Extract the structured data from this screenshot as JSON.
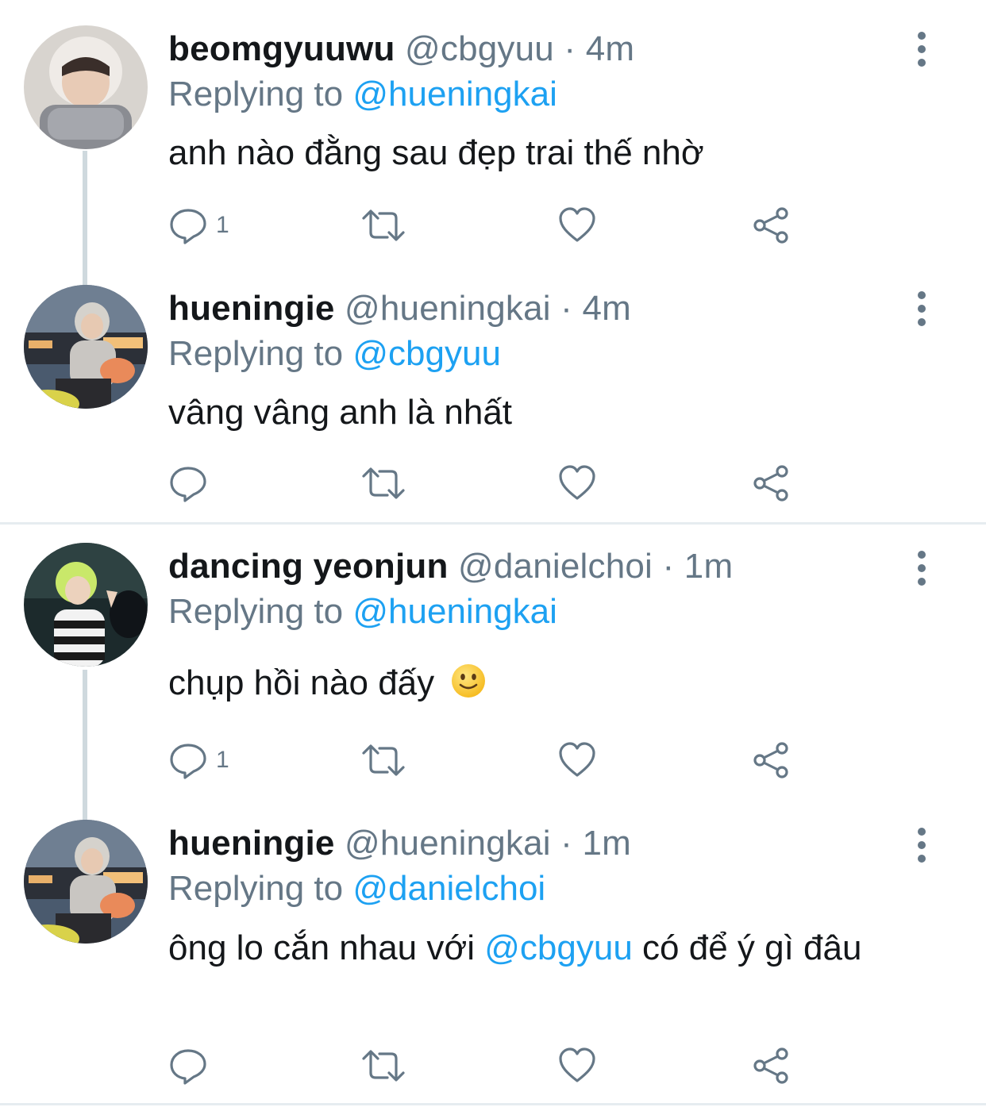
{
  "tweets": [
    {
      "display_name": "beomgyuuwu",
      "handle": "@cbgyuu",
      "separator": "·",
      "time": "4m",
      "replying_label": "Replying to",
      "replying_to": "@hueningkai",
      "text": "anh nào đằng sau đẹp trai thế nhờ",
      "reply_count": "1"
    },
    {
      "display_name": "hueningie",
      "handle": "@hueningkai",
      "separator": "·",
      "time": "4m",
      "replying_label": "Replying to",
      "replying_to": "@cbgyuu",
      "text": "vâng vâng anh là nhất",
      "reply_count": ""
    },
    {
      "display_name": "dancing yeonjun",
      "handle": "@danielchoi",
      "separator": "·",
      "time": "1m",
      "replying_label": "Replying to",
      "replying_to": "@hueningkai",
      "text": "chụp hồi nào đấy",
      "emoji": "slightly-smiling-face-icon",
      "reply_count": "1"
    },
    {
      "display_name": "hueningie",
      "handle": "@hueningkai",
      "separator": "·",
      "time": "1m",
      "replying_label": "Replying to",
      "replying_to": "@danielchoi",
      "text_before": "ông lo cắn nhau với ",
      "text_mention": "@cbgyuu",
      "text_after": " có để ý gì đâu",
      "reply_count": ""
    }
  ],
  "icons": {
    "reply": "reply-bubble-icon",
    "retweet": "retweet-icon",
    "like": "heart-icon",
    "share": "share-icon",
    "more": "more-vertical-icon"
  },
  "colors": {
    "text": "#14171a",
    "secondary": "#657786",
    "link": "#1da1f2",
    "icon": "#657786",
    "thread_line": "#cfd9de",
    "divider": "#e6ecf0"
  }
}
